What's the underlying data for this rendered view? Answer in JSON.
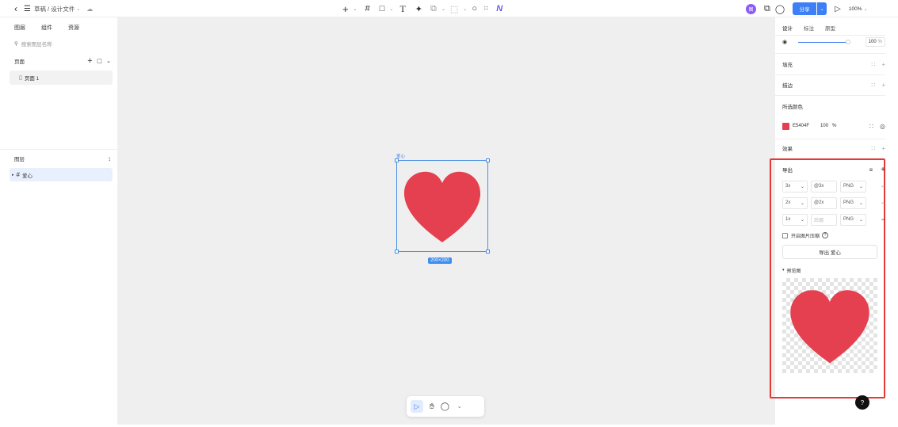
{
  "topbar": {
    "breadcrumb": "草稿 / 设计文件",
    "share_label": "分享",
    "avatar_initial": "图",
    "zoom": "100%"
  },
  "left": {
    "tabs": [
      "图层",
      "组件",
      "资源"
    ],
    "search_placeholder": "搜索图层名称",
    "pages_title": "页面",
    "page_item": "页面 1",
    "layers_title": "图层",
    "layer_item": "爱心"
  },
  "canvas": {
    "frame_label": "爱心",
    "size_label": "200×200"
  },
  "right": {
    "tabs": [
      "设计",
      "标注",
      "原型"
    ],
    "opacity": "100",
    "opacity_unit": "%",
    "fill_label": "填充",
    "stroke_label": "描边",
    "selection_colors_label": "所选颜色",
    "color_hex": "E5404F",
    "color_value": "#E5404F",
    "color_opacity": "100",
    "color_opacity_unit": "%",
    "effects_label": "效果",
    "export": {
      "title": "导出",
      "rows": [
        {
          "scale": "3x",
          "suffix": "@3x",
          "format": "PNG"
        },
        {
          "scale": "2x",
          "suffix": "@2x",
          "format": "PNG"
        },
        {
          "scale": "1x",
          "suffix": "后缀",
          "format": "PNG"
        }
      ],
      "compress_label": "开启图片压缩",
      "button_label": "导出 爱心",
      "preview_label": "预览图"
    }
  },
  "help_label": "?",
  "colors": {
    "accent": "#3d7ff5",
    "heart": "#E5404F",
    "highlight_box": "#e53935"
  }
}
